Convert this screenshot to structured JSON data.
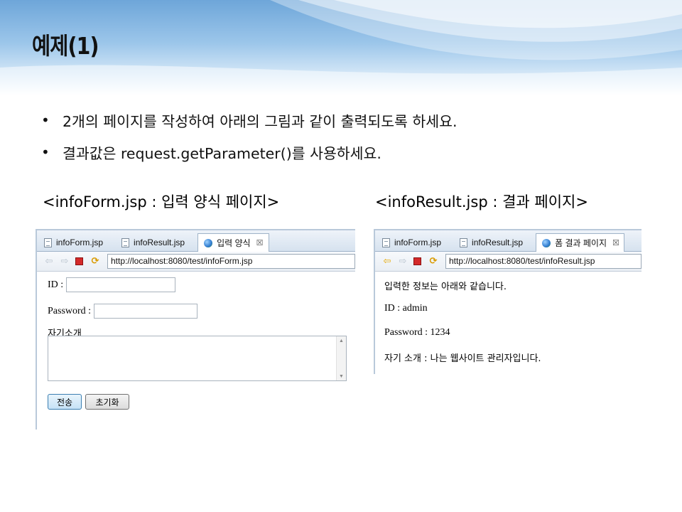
{
  "slide": {
    "title": "예제(1)",
    "bullets": [
      "2개의 페이지를 작성하여 아래의 그림과 같이 출력되도록 하세요.",
      "결과값은 request.getParameter()를  사용하세요."
    ],
    "caption_left": "<infoForm.jsp : 입력 양식 페이지>",
    "caption_right": "<infoResult.jsp  : 결과 페이지>"
  },
  "form_browser": {
    "tabs": [
      "infoForm.jsp",
      "infoResult.jsp",
      "입력 양식"
    ],
    "close_glyph": "☒",
    "url": "http://localhost:8080/test/infoForm.jsp",
    "id_label": "ID :",
    "id_value": "",
    "password_label": "Password :",
    "password_value": "",
    "intro_label": "자기소개",
    "intro_value": "",
    "submit_label": "전송",
    "reset_label": "초기화"
  },
  "result_browser": {
    "tabs": [
      "infoForm.jsp",
      "infoResult.jsp",
      "폼 결과 페이지"
    ],
    "close_glyph": "☒",
    "url": "http://localhost:8080/test/infoResult.jsp",
    "heading": "입력한 정보는 아래와 같습니다.",
    "id_line": "ID : admin",
    "password_line": "Password : 1234",
    "intro_line": "자기 소개 : 나는 웹사이트 관리자입니다."
  },
  "icons": {
    "tab_file": "file-icon",
    "tab_page": "globe-icon",
    "nav_back": "back-arrow-icon",
    "nav_forward": "forward-arrow-icon",
    "nav_stop": "stop-icon",
    "nav_refresh": "refresh-icon"
  },
  "colors": {
    "header_blue": "#6ea6d9",
    "tab_bar": "#d6e2ef",
    "stop_red": "#d42a2a",
    "refresh_orange": "#d99a00"
  }
}
